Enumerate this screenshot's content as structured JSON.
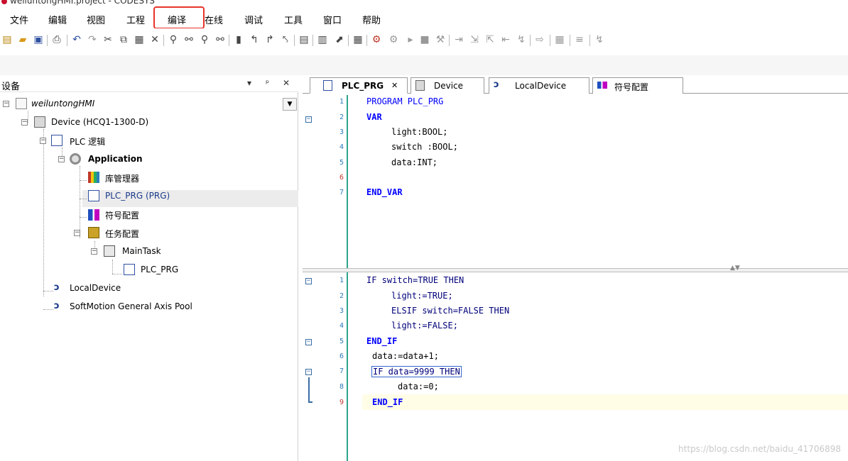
{
  "window": {
    "title": "weiluntongHMI.project - CODESYS"
  },
  "menu": {
    "items": [
      "文件",
      "编辑",
      "视图",
      "工程",
      "编译",
      "在线",
      "调试",
      "工具",
      "窗口",
      "帮助"
    ],
    "highlighted": "编译",
    "highlight_color": "#e8342a"
  },
  "devices_panel": {
    "title": "设备",
    "buttons": {
      "dropdown": "▾",
      "pin": "ᵖ",
      "close": "✕"
    },
    "tree": {
      "root": "weiluntongHMI",
      "device": "Device (HCQ1-1300-D)",
      "plc_logic": "PLC 逻辑",
      "application": "Application",
      "library_manager": "库管理器",
      "plc_prg": "PLC_PRG (PRG)",
      "symbol_config": "符号配置",
      "task_config": "任务配置",
      "main_task": "MainTask",
      "main_task_prg": "PLC_PRG",
      "local_device": "LocalDevice",
      "softmotion": "SoftMotion General Axis Pool"
    },
    "selected": "PLC_PRG (PRG)"
  },
  "editor": {
    "tabs": [
      {
        "label": "PLC_PRG",
        "active": true,
        "close": "✕"
      },
      {
        "label": "Device",
        "active": false
      },
      {
        "label": "LocalDevice",
        "active": false
      },
      {
        "label": "符号配置",
        "active": false
      }
    ],
    "declaration": {
      "line_numbers": [
        "1",
        "2",
        "3",
        "4",
        "5",
        "6",
        "7"
      ],
      "lines": [
        "PROGRAM PLC_PRG",
        "VAR",
        "light:BOOL;",
        "switch :BOOL;",
        "data:INT;",
        "",
        "END_VAR"
      ]
    },
    "body": {
      "line_numbers": [
        "1",
        "2",
        "3",
        "4",
        "5",
        "6",
        "7",
        "8",
        "9"
      ],
      "lines": [
        "IF switch=TRUE THEN",
        "light:=TRUE;",
        "ELSIF switch=FALSE THEN",
        "light:=FALSE;",
        "END_IF",
        "data:=data+1;",
        "IF data=9999 THEN",
        "data:=0;",
        "END_IF"
      ]
    },
    "split_arrows": "▲▼"
  },
  "watermark": "https://blog.csdn.net/baidu_41706898",
  "colors": {
    "keyword": "#0000ff",
    "literal": "#b45f06",
    "linenum": "#2b7bb9",
    "gutter_line": "#2ca58d"
  }
}
